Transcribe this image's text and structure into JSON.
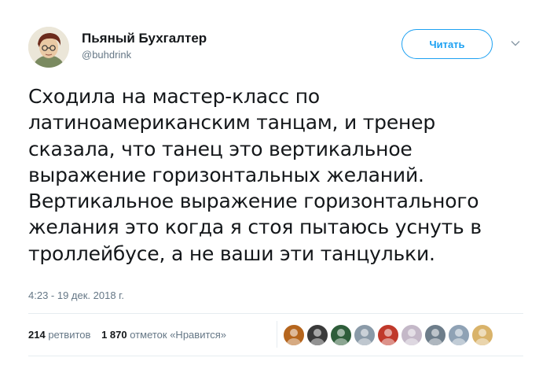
{
  "author": {
    "display_name": "Пьяный Бухгалтер",
    "handle": "@buhdrink"
  },
  "follow_button": {
    "label": "Читать"
  },
  "tweet": {
    "lines": [
      "Сходила на мастер-класс по",
      "латиноамериканским танцам, и тренер",
      "сказала, что танец это вертикальное",
      "выражение горизонтальных желаний.",
      "Вертикальное выражение горизонтального",
      "желания это когда я стоя пытаюсь уснуть в",
      "троллейбусе, а не ваши эти танцульки."
    ],
    "timestamp": "4:23 - 19 дек. 2018 г."
  },
  "stats": {
    "retweets_count": "214",
    "retweets_label": "ретвитов",
    "likes_count": "1 870",
    "likes_label": "отметок «Нравится»"
  },
  "likers": [
    {
      "icon": "avatar-icon",
      "color": "#b5651d"
    },
    {
      "icon": "avatar-icon",
      "color": "#3a3a3a"
    },
    {
      "icon": "avatar-icon",
      "color": "#2e5d3a"
    },
    {
      "icon": "avatar-icon",
      "color": "#8a9aa8"
    },
    {
      "icon": "avatar-icon",
      "color": "#c0392b"
    },
    {
      "icon": "avatar-icon",
      "color": "#c4b8c8"
    },
    {
      "icon": "avatar-icon",
      "color": "#6d7d8a"
    },
    {
      "icon": "avatar-icon",
      "color": "#8fa2b5"
    },
    {
      "icon": "avatar-icon",
      "color": "#d9b36a"
    }
  ],
  "colors": {
    "accent": "#1da1f2",
    "secondary_text": "#657786",
    "primary_text": "#14171a"
  }
}
